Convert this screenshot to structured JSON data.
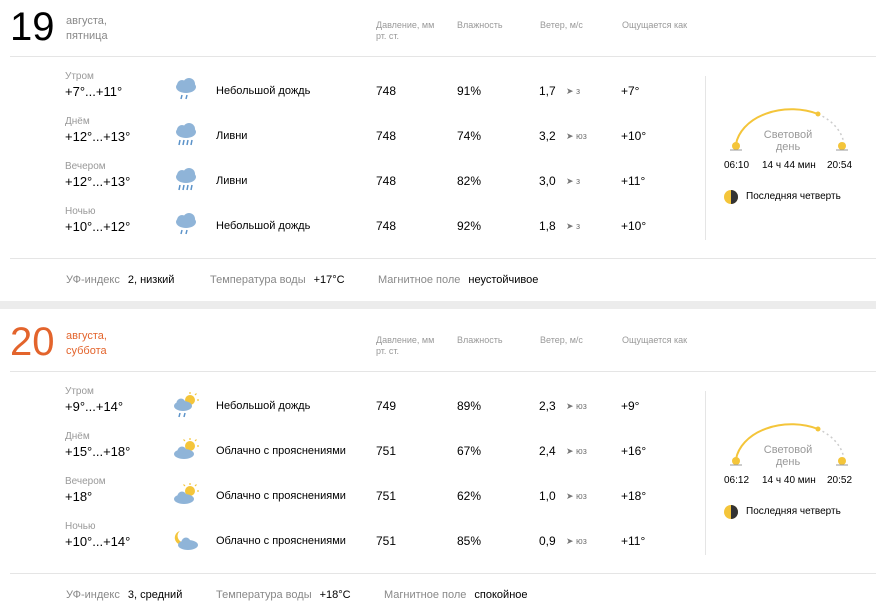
{
  "columns": {
    "pressure": "Давление, мм рт. ст.",
    "humidity": "Влажность",
    "wind": "Ветер, м/с",
    "feels": "Ощущается как"
  },
  "days": [
    {
      "num": "19",
      "date_line1": "августа,",
      "date_line2": "пятница",
      "rows": [
        {
          "part": "Утром",
          "temp": "+7°...+11°",
          "icon": "cloud-rain-icon",
          "cond": "Небольшой дождь",
          "press": "748",
          "hum": "91%",
          "wind": "1,7",
          "dir": "➤ з",
          "feel": "+7°"
        },
        {
          "part": "Днём",
          "temp": "+12°...+13°",
          "icon": "cloud-showers-icon",
          "cond": "Ливни",
          "press": "748",
          "hum": "74%",
          "wind": "3,2",
          "dir": "➤ юз",
          "feel": "+10°"
        },
        {
          "part": "Вечером",
          "temp": "+12°...+13°",
          "icon": "cloud-showers-icon",
          "cond": "Ливни",
          "press": "748",
          "hum": "82%",
          "wind": "3,0",
          "dir": "➤ з",
          "feel": "+11°"
        },
        {
          "part": "Ночью",
          "temp": "+10°...+12°",
          "icon": "cloud-rain-icon",
          "cond": "Небольшой дождь",
          "press": "748",
          "hum": "92%",
          "wind": "1,8",
          "dir": "➤ з",
          "feel": "+10°"
        }
      ],
      "sun": {
        "label": "Световой день",
        "rise": "06:10",
        "length": "14 ч 44 мин",
        "set": "20:54"
      },
      "moon": "Последняя четверть",
      "footer": {
        "uv_label": "УФ-индекс",
        "uv_value": "2, низкий",
        "water_label": "Температура воды",
        "water_value": "+17°C",
        "mag_label": "Магнитное поле",
        "mag_value": "неустойчивое"
      }
    },
    {
      "num": "20",
      "date_line1": "августа,",
      "date_line2": "суббота",
      "rows": [
        {
          "part": "Утром",
          "temp": "+9°...+14°",
          "icon": "sun-cloud-rain-icon",
          "cond": "Небольшой дождь",
          "press": "749",
          "hum": "89%",
          "wind": "2,3",
          "dir": "➤ юз",
          "feel": "+9°"
        },
        {
          "part": "Днём",
          "temp": "+15°...+18°",
          "icon": "partly-cloudy-icon",
          "cond": "Облачно с прояснениями",
          "press": "751",
          "hum": "67%",
          "wind": "2,4",
          "dir": "➤ юз",
          "feel": "+16°"
        },
        {
          "part": "Вечером",
          "temp": "+18°",
          "icon": "partly-cloudy-icon",
          "cond": "Облачно с прояснениями",
          "press": "751",
          "hum": "62%",
          "wind": "1,0",
          "dir": "➤ юз",
          "feel": "+18°"
        },
        {
          "part": "Ночью",
          "temp": "+10°...+14°",
          "icon": "moon-cloud-icon",
          "cond": "Облачно с прояснениями",
          "press": "751",
          "hum": "85%",
          "wind": "0,9",
          "dir": "➤ юз",
          "feel": "+11°"
        }
      ],
      "sun": {
        "label": "Световой день",
        "rise": "06:12",
        "length": "14 ч 40 мин",
        "set": "20:52"
      },
      "moon": "Последняя четверть",
      "footer": {
        "uv_label": "УФ-индекс",
        "uv_value": "3, средний",
        "water_label": "Температура воды",
        "water_value": "+18°C",
        "mag_label": "Магнитное поле",
        "mag_value": "спокойное"
      }
    }
  ],
  "colors": {
    "weekend": "#e3642c",
    "sun": "#f4c53a",
    "cloud": "#8fb4d8",
    "rain": "#5c93c9"
  }
}
